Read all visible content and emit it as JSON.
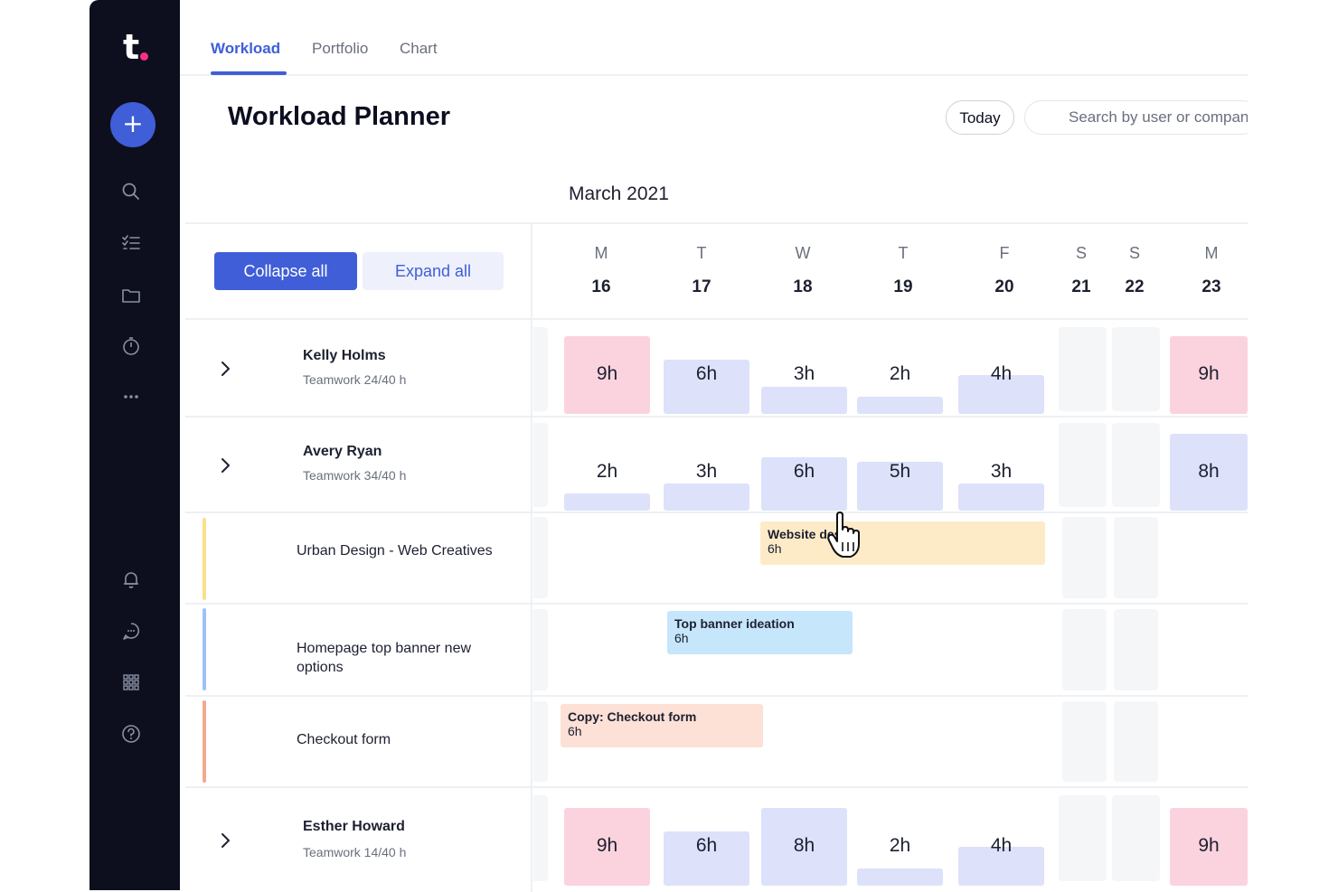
{
  "sidebar": {
    "logo": "t",
    "add_label": "+",
    "icons": [
      "search-icon",
      "tasks-icon",
      "folder-icon",
      "timer-icon",
      "more-icon",
      "bell-icon",
      "chat-icon",
      "apps-grid-icon",
      "help-icon"
    ]
  },
  "tabs": [
    {
      "label": "Workload",
      "active": true
    },
    {
      "label": "Portfolio",
      "active": false
    },
    {
      "label": "Chart",
      "active": false
    }
  ],
  "header": {
    "title": "Workload Planner",
    "today_label": "Today",
    "search_placeholder": "Search by user or company"
  },
  "calendar": {
    "month": "March 2021",
    "collapse_label": "Collapse all",
    "expand_label": "Expand all",
    "days": [
      {
        "letter": "M",
        "num": "16"
      },
      {
        "letter": "T",
        "num": "17"
      },
      {
        "letter": "W",
        "num": "18"
      },
      {
        "letter": "T",
        "num": "19"
      },
      {
        "letter": "F",
        "num": "20"
      },
      {
        "letter": "S",
        "num": "21"
      },
      {
        "letter": "S",
        "num": "22"
      },
      {
        "letter": "M",
        "num": "23"
      }
    ]
  },
  "colors": {
    "accent": "#3f5ed8",
    "over_capacity": "#fbd3de",
    "normal_load": "#dde1fa",
    "sidebar_bg": "#0d0f1e"
  },
  "rows": [
    {
      "name": "Kelly Holms",
      "sub": "Teamwork  24/40 h",
      "hours": [
        {
          "label": "9h",
          "level": 1.0,
          "over": true
        },
        {
          "label": "6h",
          "level": 0.7
        },
        {
          "label": "3h",
          "level": 0.35
        },
        {
          "label": "2h",
          "level": 0.22
        },
        {
          "label": "4h",
          "level": 0.5
        },
        {
          "label": "9h",
          "level": 1.0,
          "over": true
        }
      ]
    },
    {
      "name": "Avery Ryan",
      "sub": "Teamwork  34/40 h",
      "hours": [
        {
          "label": "2h",
          "level": 0.22
        },
        {
          "label": "3h",
          "level": 0.35
        },
        {
          "label": "6h",
          "level": 0.7
        },
        {
          "label": "5h",
          "level": 0.64
        },
        {
          "label": "3h",
          "level": 0.35
        },
        {
          "label": "8h",
          "level": 1.0
        }
      ]
    },
    {
      "name": "Esther Howard",
      "sub": "Teamwork  14/40 h",
      "hours": [
        {
          "label": "9h",
          "level": 1.0,
          "over": true
        },
        {
          "label": "6h",
          "level": 0.7
        },
        {
          "label": "8h",
          "level": 1.0
        },
        {
          "label": "2h",
          "level": 0.22
        },
        {
          "label": "4h",
          "level": 0.5
        },
        {
          "label": "9h",
          "level": 1.0,
          "over": true
        }
      ]
    }
  ],
  "projects": [
    {
      "name": "Urban Design - Web Creatives",
      "color": "#fbe08a",
      "task": {
        "name": "Website design",
        "hours": "6h",
        "color": "#fdebc8"
      }
    },
    {
      "name": "Homepage top banner new options",
      "color": "#9cc3f7",
      "task": {
        "name": "Top banner ideation",
        "hours": "6h",
        "color": "#c6e6fb"
      }
    },
    {
      "name": "Checkout form",
      "color": "#f3a98f",
      "task": {
        "name": "Copy: Checkout form",
        "hours": "6h",
        "color": "#fde0d6"
      }
    }
  ]
}
